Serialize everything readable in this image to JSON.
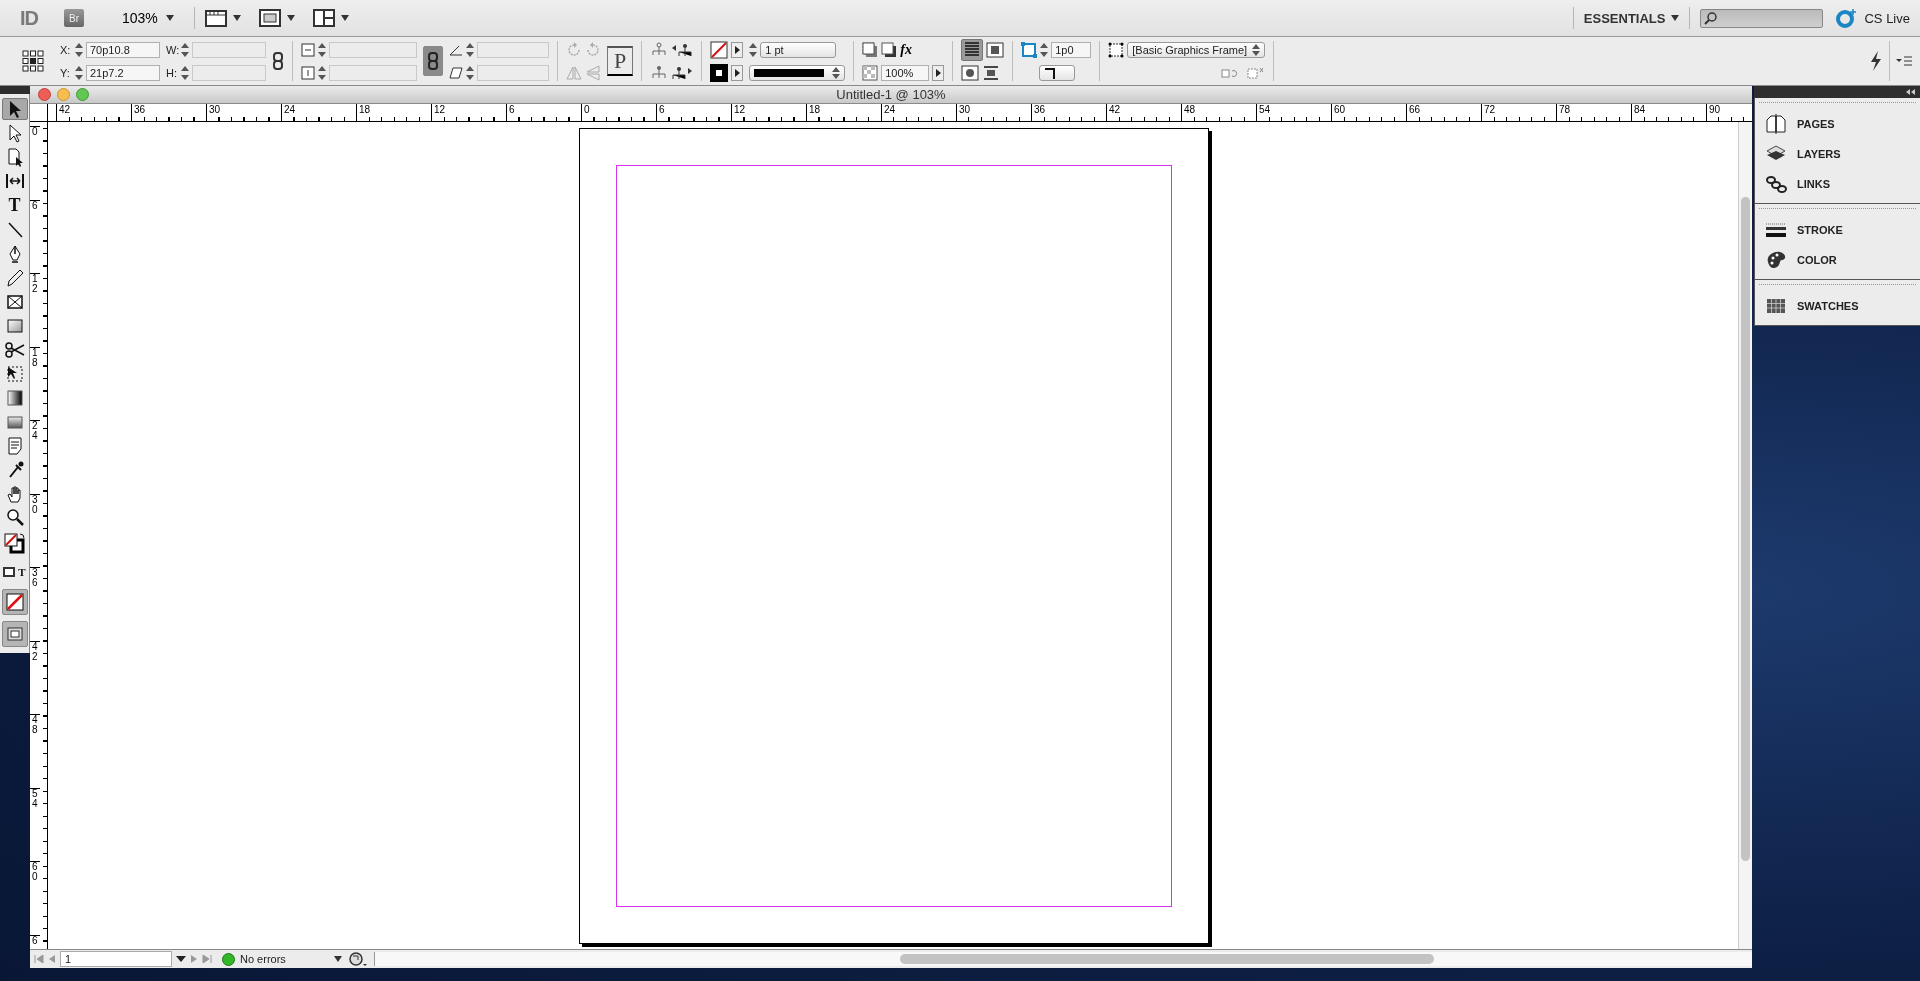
{
  "app_bar": {
    "logo": "ID",
    "bridge_button": "Br",
    "zoom": "103%",
    "workspace": "ESSENTIALS",
    "cs_live": "CS Live"
  },
  "control_panel": {
    "x_label": "X:",
    "x_value": "70p10.8",
    "y_label": "Y:",
    "y_value": "21p7.2",
    "w_label": "W:",
    "h_label": "H:",
    "constrain_proportions": true,
    "paragraph_glyph": "P",
    "stroke_weight": "1 pt",
    "effects_label": "fx",
    "opacity": "100%",
    "fitting_offset": "1p0",
    "object_style": "[Basic Graphics Frame]"
  },
  "document": {
    "title": "Untitled-1 @ 103%",
    "h_ruler": [
      "42",
      "36",
      "30",
      "24",
      "18",
      "12",
      "6",
      "0",
      "6",
      "12",
      "18",
      "24",
      "30",
      "36",
      "42",
      "48",
      "54",
      "60",
      "66",
      "72",
      "78",
      "84",
      "90"
    ],
    "v_ruler": [
      "0",
      "6",
      "12",
      "18",
      "24",
      "30",
      "36",
      "42",
      "48",
      "54",
      "60",
      "6"
    ]
  },
  "tools": [
    {
      "kind": "selection",
      "selected": true
    },
    {
      "kind": "direct-selection",
      "selected": false
    },
    {
      "kind": "page",
      "selected": false
    },
    {
      "kind": "gap",
      "selected": false
    },
    {
      "kind": "type",
      "glyph": "T",
      "selected": false
    },
    {
      "kind": "line",
      "selected": false
    },
    {
      "kind": "pen",
      "selected": false
    },
    {
      "kind": "pencil",
      "selected": false
    },
    {
      "kind": "rect-frame",
      "selected": false
    },
    {
      "kind": "rect",
      "selected": false
    },
    {
      "kind": "scissors",
      "selected": false
    },
    {
      "kind": "free-transform",
      "selected": false
    },
    {
      "kind": "gradient-swatch",
      "selected": false
    },
    {
      "kind": "gradient-feather",
      "selected": false
    },
    {
      "kind": "note",
      "selected": false
    },
    {
      "kind": "eyedropper",
      "selected": false
    },
    {
      "kind": "hand",
      "selected": false
    },
    {
      "kind": "zoom",
      "selected": false
    },
    {
      "kind": "fill-stroke",
      "selected": false
    },
    {
      "kind": "formatting",
      "glyph": "T",
      "selected": false
    },
    {
      "kind": "apply-none",
      "selected": false
    },
    {
      "kind": "screen-mode",
      "selected": false
    }
  ],
  "panels": [
    {
      "items": [
        {
          "kind": "pages",
          "label": "PAGES"
        },
        {
          "kind": "layers",
          "label": "LAYERS"
        },
        {
          "kind": "links",
          "label": "LINKS"
        }
      ]
    },
    {
      "items": [
        {
          "kind": "stroke",
          "label": "STROKE"
        },
        {
          "kind": "color",
          "label": "COLOR"
        }
      ]
    },
    {
      "items": [
        {
          "kind": "swatches",
          "label": "SWATCHES"
        }
      ]
    }
  ],
  "status_bar": {
    "page": "1",
    "preflight": "No errors"
  }
}
